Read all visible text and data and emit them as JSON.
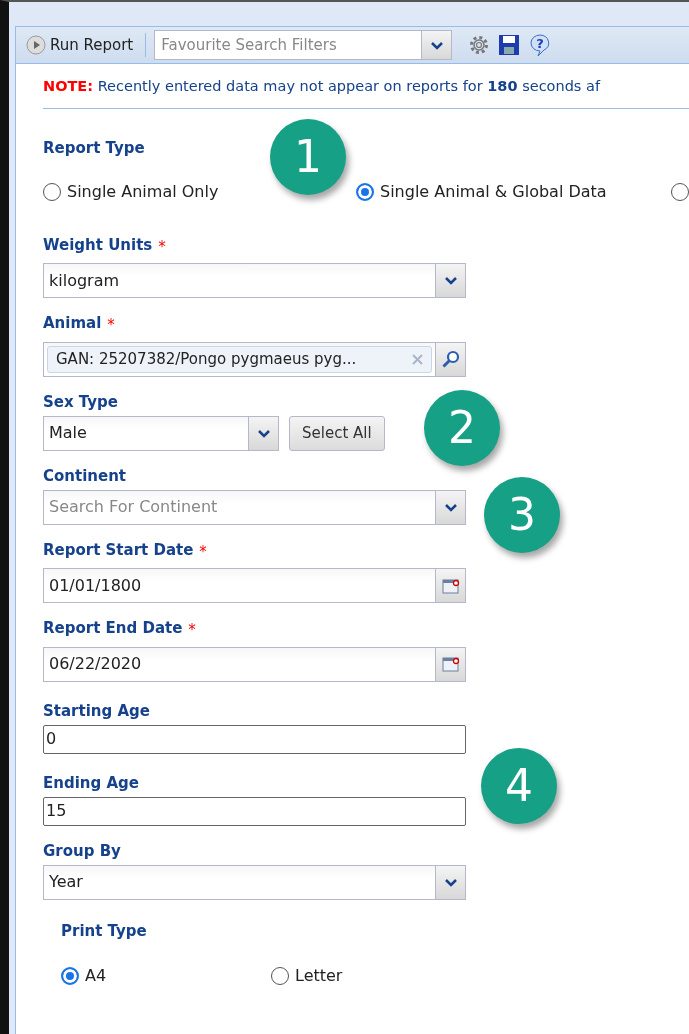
{
  "toolbar": {
    "run_button": "Run Report",
    "help_glyph": "?",
    "filter_combo": {
      "placeholder": "Favourite Search Filters"
    }
  },
  "note": {
    "label": "NOTE:",
    "text": "Recently entered data may not appear on reports for **180** seconds af"
  },
  "report_type": {
    "label": "Report Type",
    "options": [
      {
        "label": "Single Animal Only",
        "selected": false
      },
      {
        "label": "Single Animal & Global Data",
        "selected": true
      },
      {
        "selected": false
      }
    ]
  },
  "fields": [
    {
      "kind": "select",
      "label": "Weight Units",
      "required_mark": "*",
      "value": "kilogram"
    },
    {
      "kind": "lookup",
      "label": "Animal",
      "required_mark": "*",
      "value": "GAN: 25207382/Pongo pygmaeus pyg..."
    },
    {
      "kind": "select_button",
      "label": "Sex Type",
      "value": "Male",
      "button": "Select All"
    },
    {
      "kind": "select",
      "label": "Continent",
      "placeholder": "Search For Continent"
    },
    {
      "kind": "date",
      "label": "Report Start Date",
      "required_mark": "*",
      "value": "01/01/1800"
    },
    {
      "kind": "date",
      "label": "Report End Date",
      "required_mark": "*",
      "value": "06/22/2020"
    },
    {
      "kind": "text",
      "label": "Starting Age",
      "value": "0"
    },
    {
      "kind": "text",
      "label": "Ending Age",
      "value": "15"
    },
    {
      "kind": "select",
      "label": "Group By",
      "value": "Year"
    }
  ],
  "print_type": {
    "label": "Print Type",
    "options": [
      {
        "label": "A4",
        "selected": true
      },
      {
        "label": "Letter",
        "selected": false
      }
    ]
  },
  "callouts": [
    "1",
    "2",
    "3",
    "4"
  ]
}
